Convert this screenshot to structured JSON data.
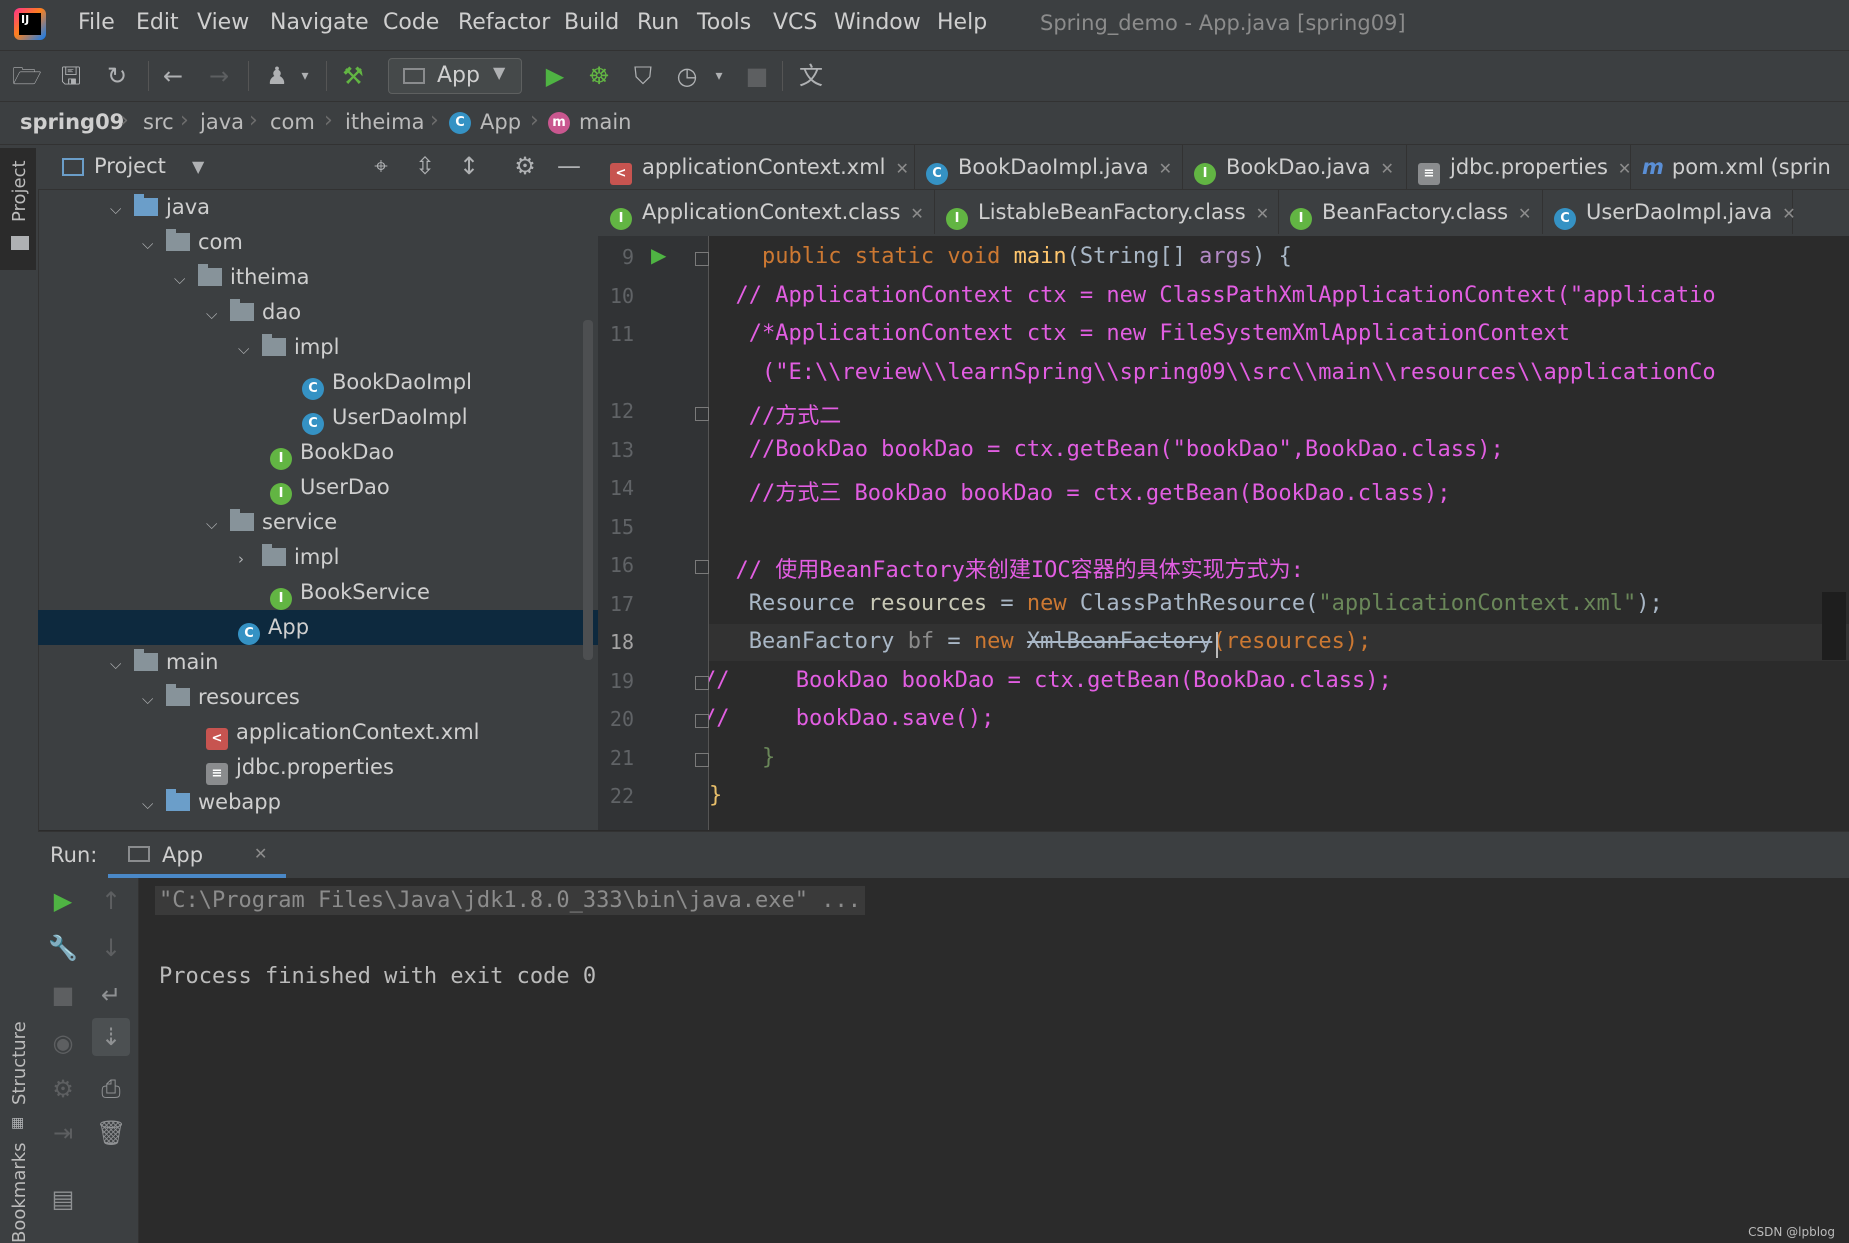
{
  "menu": [
    "File",
    "Edit",
    "View",
    "Navigate",
    "Code",
    "Refactor",
    "Build",
    "Run",
    "Tools",
    "VCS",
    "Window",
    "Help"
  ],
  "window_title": "Spring_demo - App.java [spring09]",
  "toolbar": {
    "run_config": "App"
  },
  "breadcrumb": [
    "spring09",
    "src",
    "java",
    "com",
    "itheima",
    "App",
    "main"
  ],
  "left_stripe": {
    "project_tab": "Project",
    "structure_tab": "Structure",
    "bookmarks_tab": "Bookmarks"
  },
  "project_panel": {
    "title": "Project",
    "tree": [
      {
        "label": "java",
        "type": "folder-blue",
        "expanded": true
      },
      {
        "label": "com",
        "type": "package",
        "expanded": true
      },
      {
        "label": "itheima",
        "type": "package",
        "expanded": true
      },
      {
        "label": "dao",
        "type": "package",
        "expanded": true
      },
      {
        "label": "impl",
        "type": "package",
        "expanded": true
      },
      {
        "label": "BookDaoImpl",
        "type": "class"
      },
      {
        "label": "UserDaoImpl",
        "type": "class"
      },
      {
        "label": "BookDao",
        "type": "interface"
      },
      {
        "label": "UserDao",
        "type": "interface"
      },
      {
        "label": "service",
        "type": "package",
        "expanded": true
      },
      {
        "label": "impl",
        "type": "package",
        "expanded": false
      },
      {
        "label": "BookService",
        "type": "interface"
      },
      {
        "label": "App",
        "type": "class-run",
        "selected": true
      },
      {
        "label": "main",
        "type": "folder",
        "expanded": true
      },
      {
        "label": "resources",
        "type": "resources",
        "expanded": true
      },
      {
        "label": "applicationContext.xml",
        "type": "xml"
      },
      {
        "label": "jdbc.properties",
        "type": "properties"
      },
      {
        "label": "webapp",
        "type": "folder-web",
        "expanded": true
      }
    ]
  },
  "editor_tabs_row1": [
    {
      "label": "applicationContext.xml",
      "icon": "xml"
    },
    {
      "label": "BookDaoImpl.java",
      "icon": "class"
    },
    {
      "label": "BookDao.java",
      "icon": "interface"
    },
    {
      "label": "jdbc.properties",
      "icon": "properties"
    },
    {
      "label": "pom.xml (sprin",
      "icon": "maven"
    }
  ],
  "editor_tabs_row2": [
    {
      "label": "ApplicationContext.class",
      "icon": "interface"
    },
    {
      "label": "ListableBeanFactory.class",
      "icon": "interface"
    },
    {
      "label": "BeanFactory.class",
      "icon": "interface"
    },
    {
      "label": "UserDaoImpl.java",
      "icon": "class"
    }
  ],
  "code": {
    "line_numbers": [
      "9",
      "10",
      "11",
      "",
      "12",
      "13",
      "14",
      "15",
      "16",
      "17",
      "18",
      "19",
      "20",
      "21",
      "22"
    ],
    "current_line": "18",
    "l9": {
      "indent": "    ",
      "a": "public static void ",
      "b": "main",
      "c": "(String[] ",
      "d": "args",
      ",e": ") {",
      "e": ") {"
    },
    "l10": "  // ApplicationContext ctx = new ClassPathXmlApplicationContext(\"applicatio",
    "l11": "   /*ApplicationContext ctx = new FileSystemXmlApplicationContext",
    "l11b": "    (\"E:\\\\review\\\\learnSpring\\\\spring09\\\\src\\\\main\\\\resources\\\\applicationCo",
    "l12": "   //方式二",
    "l13": "   //BookDao bookDao = ctx.getBean(\"bookDao\",BookDao.class);",
    "l14": "   //方式三 BookDao bookDao = ctx.getBean(BookDao.class);",
    "l16": "  // 使用BeanFactory来创建IOC容器的具体实现方式为:",
    "l17": {
      "a": "   Resource ",
      "b": "resources",
      " c": "",
      "c": " = ",
      "d": "new ",
      "e": "ClassPathResource(",
      "f": "\"applicationContext.xml\"",
      "g": ");"
    },
    "l18": {
      "a": "   BeanFactory ",
      "b": "bf",
      " c": "",
      "c": " = ",
      "d": "new ",
      "e": "XmlBeanFactory",
      "f": "(resources);"
    },
    "l19": {
      "prefix": "//",
      "body": "     BookDao bookDao = ctx.getBean(BookDao.class);"
    },
    "l20": {
      "prefix": "//",
      "body": "     bookDao.save();"
    },
    "l21": "    }",
    "l22": "}"
  },
  "run_panel": {
    "label": "Run:",
    "tab": "App",
    "command": "\"C:\\Program Files\\Java\\jdk1.8.0_333\\bin\\java.exe\" ...",
    "output": "Process finished with exit code 0"
  },
  "watermark": "CSDN @lpblog",
  "colors": {
    "keyword": "#cc7832",
    "comment_pink": "#e25ee2",
    "string": "#6a8759",
    "method": "#ffc66d",
    "selection": "#0d293e"
  }
}
